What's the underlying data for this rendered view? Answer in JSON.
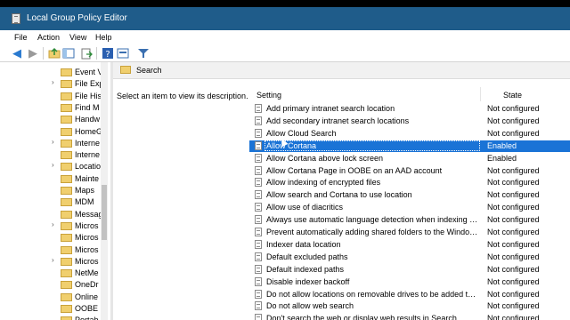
{
  "window": {
    "title": "Local Group Policy Editor",
    "icon": "gpedit-icon"
  },
  "menu": [
    "File",
    "Action",
    "View",
    "Help"
  ],
  "toolbar": [
    "back-icon",
    "forward-icon",
    "up-folder-icon",
    "show-hide-tree-icon",
    "export-list-icon",
    "help-icon",
    "properties-icon",
    "filter-icon"
  ],
  "tree": {
    "items": [
      {
        "label": "Event V",
        "expandable": false
      },
      {
        "label": "File Exp",
        "expandable": true
      },
      {
        "label": "File His",
        "expandable": false
      },
      {
        "label": "Find M",
        "expandable": false
      },
      {
        "label": "Handw",
        "expandable": false
      },
      {
        "label": "HomeG",
        "expandable": false
      },
      {
        "label": "Interne",
        "expandable": true
      },
      {
        "label": "Interne",
        "expandable": false
      },
      {
        "label": "Locatio",
        "expandable": true
      },
      {
        "label": "Mainte",
        "expandable": false
      },
      {
        "label": "Maps",
        "expandable": false
      },
      {
        "label": "MDM",
        "expandable": false
      },
      {
        "label": "Messag",
        "expandable": false
      },
      {
        "label": "Micros",
        "expandable": true
      },
      {
        "label": "Micros",
        "expandable": false
      },
      {
        "label": "Micros",
        "expandable": false
      },
      {
        "label": "Micros",
        "expandable": true
      },
      {
        "label": "NetMe",
        "expandable": false
      },
      {
        "label": "OneDr",
        "expandable": false
      },
      {
        "label": "Online",
        "expandable": false
      },
      {
        "label": "OOBE",
        "expandable": false
      },
      {
        "label": "Portab",
        "expandable": false
      }
    ]
  },
  "panel": {
    "header": "Search",
    "description": "Select an item to view its description.",
    "columns": {
      "setting": "Setting",
      "state": "State"
    },
    "rows": [
      {
        "name": "Add primary intranet search location",
        "state": "Not configured"
      },
      {
        "name": "Add secondary intranet search locations",
        "state": "Not configured"
      },
      {
        "name": "Allow Cloud Search",
        "state": "Not configured"
      },
      {
        "name": "Allow Cortana",
        "state": "Enabled",
        "selected": true
      },
      {
        "name": "Allow Cortana above lock screen",
        "state": "Enabled"
      },
      {
        "name": "Allow Cortana Page in OOBE on an AAD account",
        "state": "Not configured"
      },
      {
        "name": "Allow indexing of encrypted files",
        "state": "Not configured"
      },
      {
        "name": "Allow search and Cortana to use location",
        "state": "Not configured"
      },
      {
        "name": "Allow use of diacritics",
        "state": "Not configured"
      },
      {
        "name": "Always use automatic language detection when indexing con...",
        "state": "Not configured"
      },
      {
        "name": "Prevent automatically adding shared folders to the Windows ...",
        "state": "Not configured"
      },
      {
        "name": "Indexer data location",
        "state": "Not configured"
      },
      {
        "name": "Default excluded paths",
        "state": "Not configured"
      },
      {
        "name": "Default indexed paths",
        "state": "Not configured"
      },
      {
        "name": "Disable indexer backoff",
        "state": "Not configured"
      },
      {
        "name": "Do not allow locations on removable drives to be added to li...",
        "state": "Not configured"
      },
      {
        "name": "Do not allow web search",
        "state": "Not configured"
      },
      {
        "name": "Don't search the web or display web results in Search",
        "state": "Not configured"
      }
    ]
  },
  "colors": {
    "titlebar": "#1f5c8a",
    "selection": "#1a73d6",
    "folder": "#f0cf6e"
  }
}
